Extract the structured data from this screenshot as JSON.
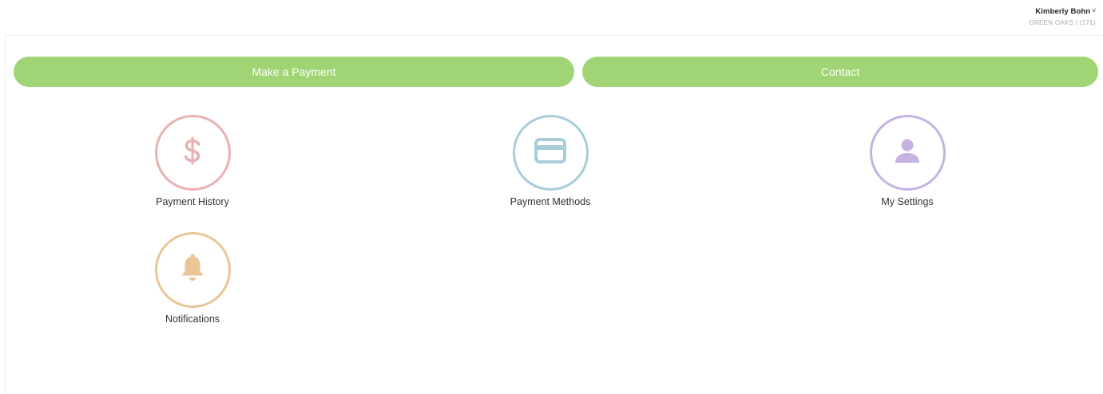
{
  "header": {
    "user_name": "Kimberly Bohn",
    "user_org": "GREEN OAKS I (171)",
    "chevron_glyph": "˅"
  },
  "actions": {
    "make_payment": "Make a Payment",
    "contact": "Contact"
  },
  "tiles": [
    {
      "label": "Payment History",
      "icon": "dollar-icon",
      "color": "#e8b2b2"
    },
    {
      "label": "Payment Methods",
      "icon": "credit-card-icon",
      "color": "#a7cdd9"
    },
    {
      "label": "My Settings",
      "icon": "user-icon",
      "color": "#c5b2e3"
    },
    {
      "label": "Notifications",
      "icon": "bell-icon",
      "color": "#ebc596"
    }
  ],
  "colors": {
    "button_green": "#a1d474"
  }
}
